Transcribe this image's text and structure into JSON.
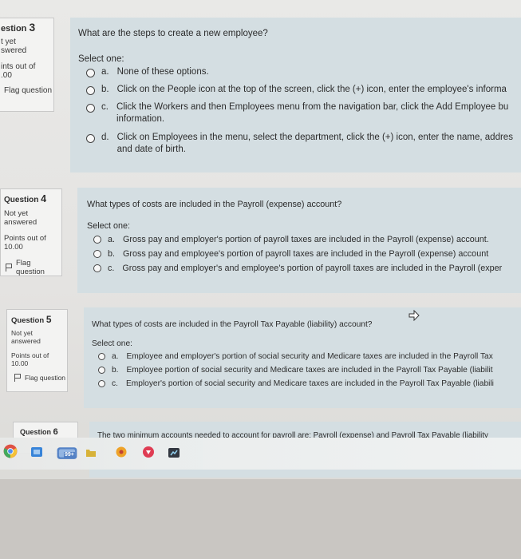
{
  "q3": {
    "title": "estion",
    "num": "3",
    "status1": "t yet",
    "status2": "swered",
    "points1": "ints out of",
    "points2": ".00",
    "flag": "Flag question",
    "question": "What are the steps to create a new employee?",
    "select": "Select one:",
    "options": [
      {
        "letter": "a.",
        "text": "None of these options."
      },
      {
        "letter": "b.",
        "text": "Click on the People icon at the top of the screen, click the (+) icon, enter the employee's informa"
      },
      {
        "letter": "c.",
        "text": "Click the Workers and then Employees menu from the navigation bar, click the Add Employee bu",
        "text2": "information."
      },
      {
        "letter": "d.",
        "text": "Click on Employees in the menu, select the department, click the (+) icon, enter the name, addres",
        "text2": "and date of birth."
      }
    ]
  },
  "q4": {
    "title": "Question",
    "num": "4",
    "status1": "Not yet",
    "status2": "answered",
    "points1": "Points out of",
    "points2": "10.00",
    "flag": "Flag question",
    "question": "What types of costs are included in the Payroll (expense) account?",
    "select": "Select one:",
    "options": [
      {
        "letter": "a.",
        "text": "Gross pay and employer's portion of payroll taxes are included in the Payroll (expense) account."
      },
      {
        "letter": "b.",
        "text": "Gross pay and employee's portion of payroll taxes are included in the Payroll (expense) account"
      },
      {
        "letter": "c.",
        "text": "Gross pay and employer's and employee's portion of payroll taxes are included in the Payroll (exper"
      }
    ]
  },
  "q5": {
    "title": "Question",
    "num": "5",
    "status1": "Not yet",
    "status2": "answered",
    "points1": "Points out of",
    "points2": "10.00",
    "flag": "Flag question",
    "question": "What types of costs are included in the Payroll Tax Payable (liability) account?",
    "select": "Select one:",
    "options": [
      {
        "letter": "a.",
        "text": "Employee and employer's portion of social security and Medicare taxes are included in the Payroll Tax"
      },
      {
        "letter": "b.",
        "text": "Employee portion of social security and Medicare taxes are included in the Payroll Tax Payable (liabilit"
      },
      {
        "letter": "c.",
        "text": "Employer's portion of social security and Medicare taxes are included in the Payroll Tax Payable (liabili"
      }
    ]
  },
  "q6": {
    "title": "Question",
    "num": "6",
    "question": "The two minimum accounts needed to account for payroll are: Payroll (expense) and Payroll Tax Payable (liability"
  },
  "taskbar": {
    "badge": "99+",
    "icons": [
      "chrome-icon",
      "mail-icon",
      "photos-icon",
      "folder-icon",
      "pokemon-icon",
      "shield-icon",
      "camera-icon"
    ]
  },
  "colors": {
    "content_bg": "#d4dee2",
    "info_bg": "#f3f3f2"
  }
}
